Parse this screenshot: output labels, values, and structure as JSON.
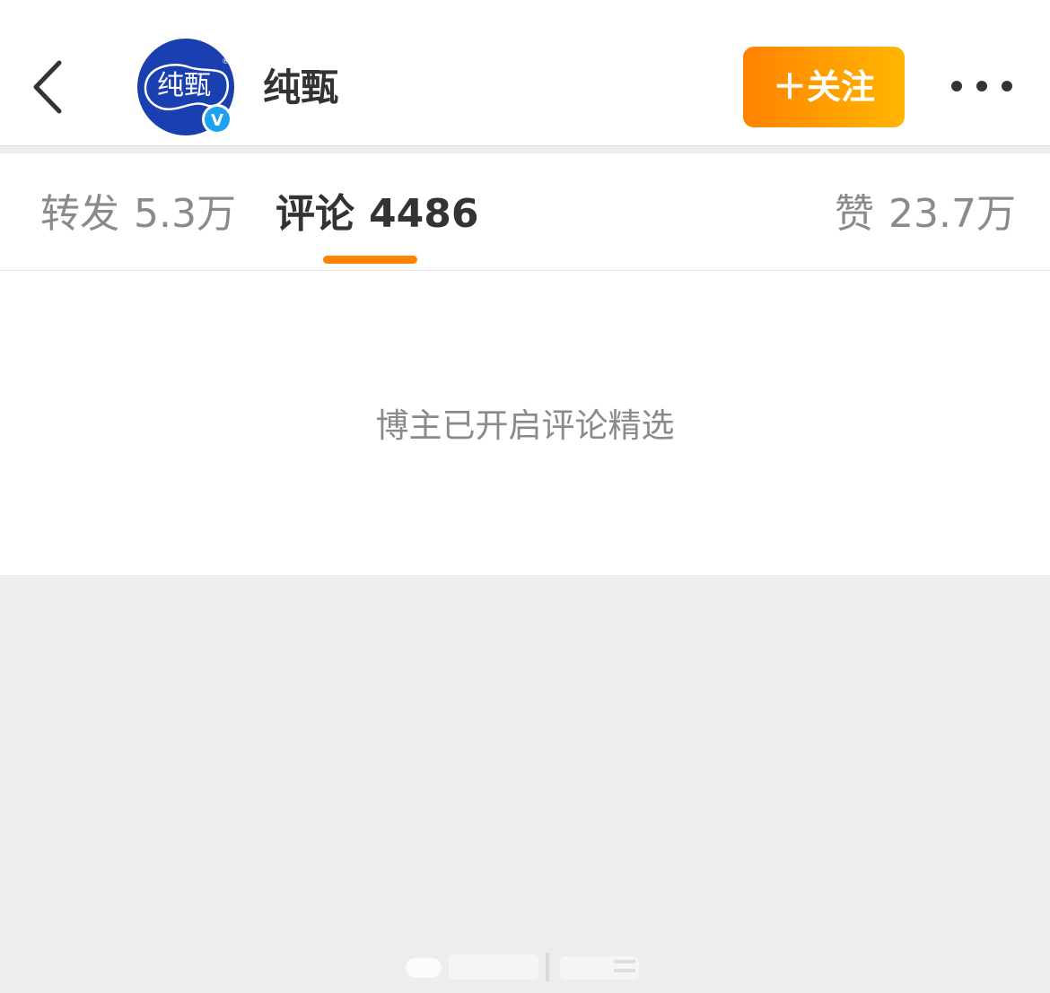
{
  "header": {
    "account_name": "纯甄",
    "avatar_text": "纯甄",
    "follow_label": "＋关注",
    "verified_badge": "V",
    "back_icon": "chevron-left-icon",
    "more_icon": "more-dots-icon"
  },
  "tabs": [
    {
      "label": "转发",
      "count": "5.3万"
    },
    {
      "label": "评论",
      "count": "4486"
    },
    {
      "label": "赞",
      "count": "23.7万"
    }
  ],
  "active_tab": "评论",
  "content": {
    "notice": "博主已开启评论精选"
  },
  "colors": {
    "accent": "#ff8200",
    "follow_gradient_end": "#ffb600",
    "avatar_blue": "#1a3fb0",
    "verified_blue": "#1da1f2"
  }
}
